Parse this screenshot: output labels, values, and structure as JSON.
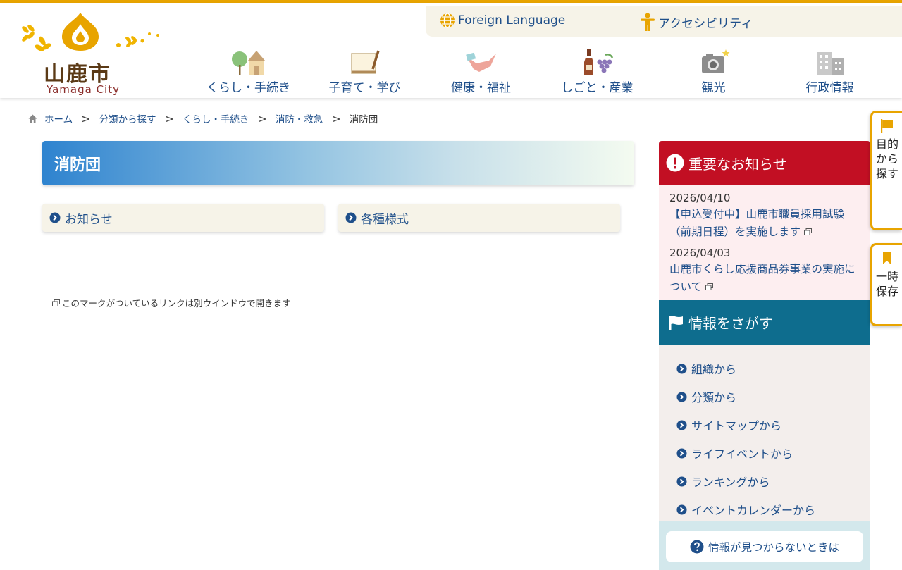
{
  "site": {
    "logo_kanji": "山鹿市",
    "logo_romaji": "Yamaga City"
  },
  "utility": {
    "foreign_language": "Foreign Language",
    "accessibility": "アクセシビリティ"
  },
  "global_nav": [
    {
      "label": "くらし・手続き",
      "icon": "house-tree-icon"
    },
    {
      "label": "子育て・学び",
      "icon": "notebook-pencil-icon"
    },
    {
      "label": "健康・福祉",
      "icon": "bird-icon"
    },
    {
      "label": "しごと・産業",
      "icon": "bottle-grapes-icon"
    },
    {
      "label": "観光",
      "icon": "camera-icon"
    },
    {
      "label": "行政情報",
      "icon": "building-icon"
    }
  ],
  "breadcrumb": {
    "items": [
      "ホーム",
      "分類から探す",
      "くらし・手続き",
      "消防・救急"
    ],
    "separator": ">",
    "current": "消防団"
  },
  "page": {
    "title": "消防団",
    "links": [
      "お知らせ",
      "各種様式"
    ],
    "external_notice": "このマークがついているリンクは別ウインドウで開きます"
  },
  "important": {
    "heading": "重要なお知らせ",
    "items": [
      {
        "date": "2026/04/10",
        "title": "【申込受付中】山鹿市職員採用試験（前期日程）を実施します"
      },
      {
        "date": "2026/04/03",
        "title": "山鹿市くらし応援商品券事業の実施について"
      }
    ]
  },
  "find_info": {
    "heading": "情報をさがす",
    "items": [
      "組織から",
      "分類から",
      "サイトマップから",
      "ライフイベントから",
      "ランキングから",
      "イベントカレンダーから"
    ],
    "faq_button": "情報が見つからないときは"
  },
  "floating": {
    "search_by_purpose": "目的から探す",
    "temporary_save": "一時保存"
  },
  "colors": {
    "accent_gold": "#e8a400",
    "link_blue": "#1f4f8a",
    "important_red": "#c20f23",
    "find_teal": "#0e6d8e"
  }
}
